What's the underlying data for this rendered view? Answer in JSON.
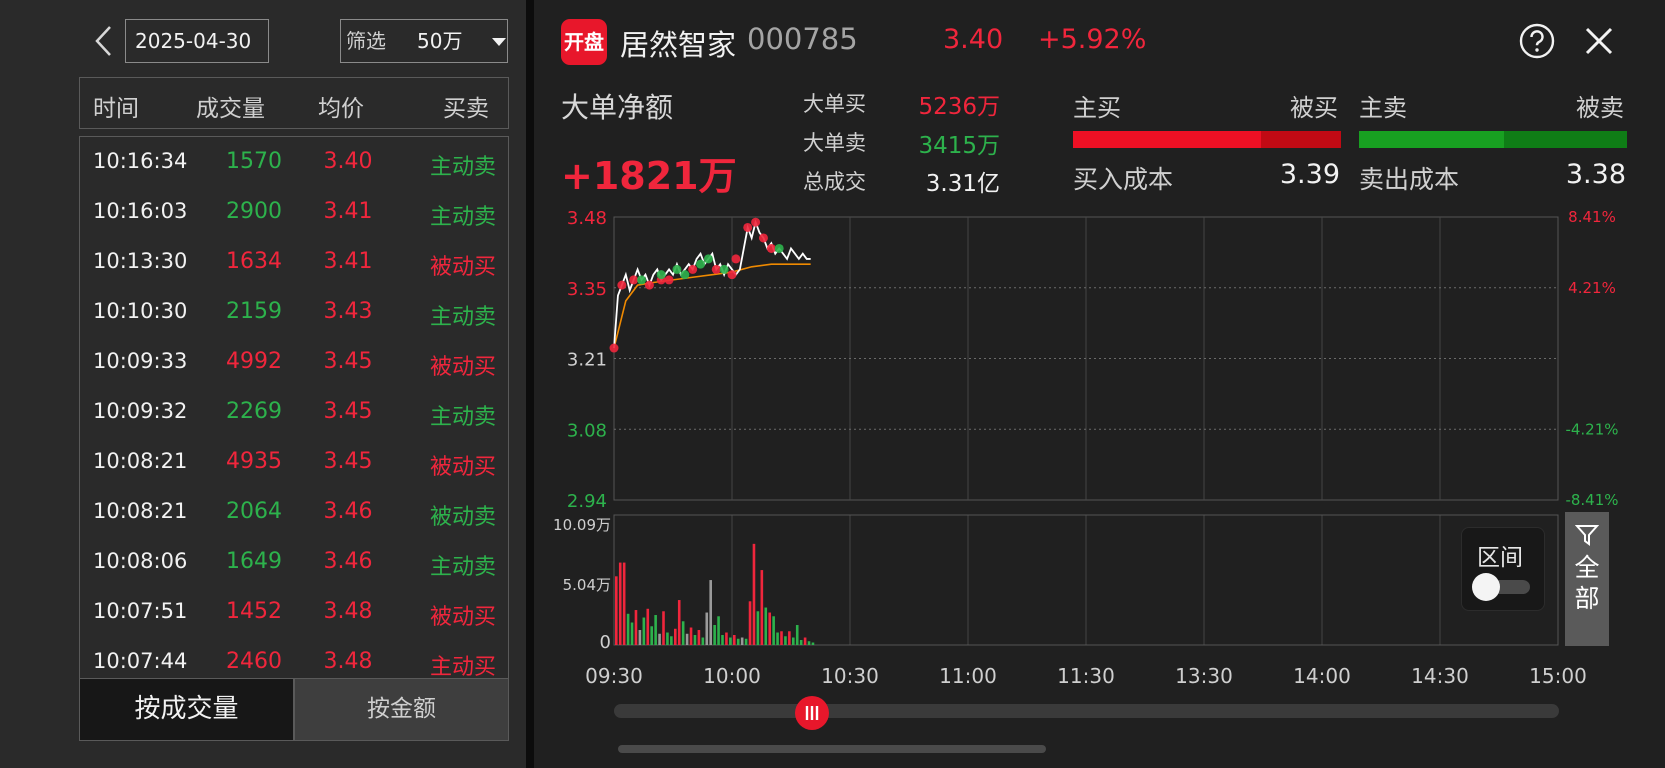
{
  "left": {
    "date": "2025-04-30",
    "filter": {
      "label": "筛选",
      "value": "50万"
    },
    "columns": [
      "时间",
      "成交量",
      "均价",
      "买卖"
    ],
    "rows": [
      {
        "time": "10:16:34",
        "volume": "1570",
        "price": "3.40",
        "type": "主动卖",
        "vol_color": "green",
        "type_color": "green"
      },
      {
        "time": "10:16:03",
        "volume": "2900",
        "price": "3.41",
        "type": "主动卖",
        "vol_color": "green",
        "type_color": "green"
      },
      {
        "time": "10:13:30",
        "volume": "1634",
        "price": "3.41",
        "type": "被动买",
        "vol_color": "red",
        "type_color": "red"
      },
      {
        "time": "10:10:30",
        "volume": "2159",
        "price": "3.43",
        "type": "主动卖",
        "vol_color": "green",
        "type_color": "green"
      },
      {
        "time": "10:09:33",
        "volume": "4992",
        "price": "3.45",
        "type": "被动买",
        "vol_color": "red",
        "type_color": "red"
      },
      {
        "time": "10:09:32",
        "volume": "2269",
        "price": "3.45",
        "type": "主动卖",
        "vol_color": "green",
        "type_color": "green"
      },
      {
        "time": "10:08:21",
        "volume": "4935",
        "price": "3.45",
        "type": "被动买",
        "vol_color": "red",
        "type_color": "red"
      },
      {
        "time": "10:08:21",
        "volume": "2064",
        "price": "3.46",
        "type": "被动卖",
        "vol_color": "green",
        "type_color": "green"
      },
      {
        "time": "10:08:06",
        "volume": "1649",
        "price": "3.46",
        "type": "主动卖",
        "vol_color": "green",
        "type_color": "green"
      },
      {
        "time": "10:07:51",
        "volume": "1452",
        "price": "3.48",
        "type": "被动买",
        "vol_color": "red",
        "type_color": "red"
      },
      {
        "time": "10:07:44",
        "volume": "2460",
        "price": "3.48",
        "type": "主动买",
        "vol_color": "red",
        "type_color": "red"
      }
    ],
    "tabs": {
      "by_volume": "按成交量",
      "by_amount": "按金额"
    }
  },
  "header": {
    "logo": "开盘",
    "name": "居然智家",
    "code": "000785",
    "price": "3.40",
    "change": "+5.92%"
  },
  "summary": {
    "title": "大单净额",
    "net": "+1821万",
    "big_buy_label": "大单买",
    "big_buy": "5236万",
    "big_sell_label": "大单卖",
    "big_sell": "3415万",
    "total_label": "总成交",
    "total": "3.31亿"
  },
  "flow": {
    "buy_active": "主买",
    "buy_passive": "被买",
    "sell_active": "主卖",
    "sell_passive": "被卖",
    "buy_active_share": 0.7,
    "sell_active_share": 0.54,
    "buy_cost_label": "买入成本",
    "buy_cost": "3.39",
    "sell_cost_label": "卖出成本",
    "sell_cost": "3.38"
  },
  "colors": {
    "red": "#f0263c",
    "green": "#2db24c",
    "avg_line": "#f08a00",
    "price_line": "#ffffff"
  },
  "chart_data": {
    "type": "line",
    "price_ticks": [
      "3.48",
      "3.35",
      "3.21",
      "3.08",
      "2.94"
    ],
    "pct_ticks": [
      "8.41%",
      "4.21%",
      "",
      "-4.21%",
      "-8.41%"
    ],
    "prev_close": 3.21,
    "ylim": [
      2.94,
      3.48
    ],
    "x_ticks": [
      "09:30",
      "10:00",
      "10:30",
      "11:00",
      "11:30",
      "13:30",
      "14:00",
      "14:30",
      "15:00"
    ],
    "grid": true,
    "price_series": {
      "minutes": [
        0,
        1,
        2,
        3,
        4,
        5,
        6,
        7,
        8,
        9,
        10,
        11,
        12,
        13,
        14,
        15,
        16,
        17,
        18,
        19,
        20,
        21,
        22,
        23,
        24,
        25,
        26,
        27,
        28,
        29,
        30,
        31,
        32,
        33,
        34,
        35,
        36,
        37,
        38,
        39,
        40,
        41,
        42,
        43,
        44,
        45,
        46,
        47,
        48,
        49,
        50
      ],
      "values": [
        3.23,
        3.33,
        3.35,
        3.37,
        3.34,
        3.36,
        3.38,
        3.36,
        3.37,
        3.35,
        3.37,
        3.38,
        3.36,
        3.37,
        3.38,
        3.37,
        3.39,
        3.37,
        3.38,
        3.39,
        3.38,
        3.4,
        3.41,
        3.39,
        3.4,
        3.41,
        3.38,
        3.39,
        3.37,
        3.39,
        3.38,
        3.37,
        3.38,
        3.42,
        3.46,
        3.44,
        3.47,
        3.45,
        3.44,
        3.42,
        3.43,
        3.41,
        3.42,
        3.41,
        3.4,
        3.42,
        3.41,
        3.4,
        3.41,
        3.4,
        3.4
      ]
    },
    "avg_series": {
      "minutes": [
        0,
        3,
        6,
        10,
        15,
        20,
        25,
        30,
        35,
        40,
        45,
        50
      ],
      "values": [
        3.23,
        3.32,
        3.35,
        3.355,
        3.36,
        3.365,
        3.37,
        3.375,
        3.385,
        3.39,
        3.39,
        3.39
      ]
    },
    "trade_markers": [
      {
        "minute": 0,
        "price": 3.23,
        "side": "buy"
      },
      {
        "minute": 2,
        "price": 3.35,
        "side": "buy"
      },
      {
        "minute": 5,
        "price": 3.36,
        "side": "buy"
      },
      {
        "minute": 7,
        "price": 3.36,
        "side": "sell"
      },
      {
        "minute": 9,
        "price": 3.35,
        "side": "buy"
      },
      {
        "minute": 12,
        "price": 3.36,
        "side": "buy"
      },
      {
        "minute": 12,
        "price": 3.37,
        "side": "sell"
      },
      {
        "minute": 14,
        "price": 3.36,
        "side": "buy"
      },
      {
        "minute": 16,
        "price": 3.38,
        "side": "sell"
      },
      {
        "minute": 18,
        "price": 3.37,
        "side": "sell"
      },
      {
        "minute": 20,
        "price": 3.38,
        "side": "buy"
      },
      {
        "minute": 22,
        "price": 3.39,
        "side": "sell"
      },
      {
        "minute": 24,
        "price": 3.4,
        "side": "sell"
      },
      {
        "minute": 26,
        "price": 3.38,
        "side": "buy"
      },
      {
        "minute": 28,
        "price": 3.38,
        "side": "sell"
      },
      {
        "minute": 30,
        "price": 3.37,
        "side": "buy"
      },
      {
        "minute": 31,
        "price": 3.4,
        "side": "buy"
      },
      {
        "minute": 34,
        "price": 3.46,
        "side": "buy"
      },
      {
        "minute": 36,
        "price": 3.47,
        "side": "buy"
      },
      {
        "minute": 38,
        "price": 3.44,
        "side": "buy"
      },
      {
        "minute": 40,
        "price": 3.42,
        "side": "buy"
      },
      {
        "minute": 42,
        "price": 3.42,
        "side": "sell"
      }
    ],
    "volume": {
      "ticks": [
        "10.09万",
        "5.04万",
        "0"
      ],
      "max": 10.09,
      "bars": [
        {
          "minute": 0,
          "value": 5.5,
          "side": "buy"
        },
        {
          "minute": 1,
          "value": 6.6,
          "side": "buy"
        },
        {
          "minute": 2,
          "value": 6.6,
          "side": "buy"
        },
        {
          "minute": 3,
          "value": 2.5,
          "side": "sell"
        },
        {
          "minute": 4,
          "value": 1.8,
          "side": "sell"
        },
        {
          "minute": 5,
          "value": 2.8,
          "side": "buy"
        },
        {
          "minute": 6,
          "value": 1.2,
          "side": "neutral"
        },
        {
          "minute": 7,
          "value": 2.2,
          "side": "sell"
        },
        {
          "minute": 8,
          "value": 2.9,
          "side": "buy"
        },
        {
          "minute": 9,
          "value": 1.5,
          "side": "sell"
        },
        {
          "minute": 10,
          "value": 2.4,
          "side": "sell"
        },
        {
          "minute": 11,
          "value": 0.9,
          "side": "neutral"
        },
        {
          "minute": 12,
          "value": 2.7,
          "side": "buy"
        },
        {
          "minute": 13,
          "value": 1.0,
          "side": "sell"
        },
        {
          "minute": 14,
          "value": 0.7,
          "side": "sell"
        },
        {
          "minute": 15,
          "value": 1.3,
          "side": "buy"
        },
        {
          "minute": 16,
          "value": 3.6,
          "side": "buy"
        },
        {
          "minute": 17,
          "value": 1.9,
          "side": "sell"
        },
        {
          "minute": 18,
          "value": 0.9,
          "side": "neutral"
        },
        {
          "minute": 19,
          "value": 1.4,
          "side": "buy"
        },
        {
          "minute": 20,
          "value": 0.8,
          "side": "sell"
        },
        {
          "minute": 21,
          "value": 1.2,
          "side": "buy"
        },
        {
          "minute": 22,
          "value": 0.6,
          "side": "sell"
        },
        {
          "minute": 23,
          "value": 2.6,
          "side": "neutral"
        },
        {
          "minute": 24,
          "value": 5.2,
          "side": "neutral"
        },
        {
          "minute": 25,
          "value": 1.6,
          "side": "sell"
        },
        {
          "minute": 26,
          "value": 2.3,
          "side": "sell"
        },
        {
          "minute": 27,
          "value": 0.8,
          "side": "sell"
        },
        {
          "minute": 28,
          "value": 1.0,
          "side": "buy"
        },
        {
          "minute": 29,
          "value": 0.6,
          "side": "sell"
        },
        {
          "minute": 30,
          "value": 0.8,
          "side": "buy"
        },
        {
          "minute": 31,
          "value": 0.5,
          "side": "sell"
        },
        {
          "minute": 32,
          "value": 0.6,
          "side": "neutral"
        },
        {
          "minute": 33,
          "value": 0.5,
          "side": "sell"
        },
        {
          "minute": 34,
          "value": 3.5,
          "side": "buy"
        },
        {
          "minute": 35,
          "value": 8.1,
          "side": "buy"
        },
        {
          "minute": 36,
          "value": 2.7,
          "side": "sell"
        },
        {
          "minute": 37,
          "value": 6.0,
          "side": "buy"
        },
        {
          "minute": 38,
          "value": 3.0,
          "side": "sell"
        },
        {
          "minute": 39,
          "value": 2.6,
          "side": "buy"
        },
        {
          "minute": 40,
          "value": 2.3,
          "side": "sell"
        },
        {
          "minute": 41,
          "value": 1.0,
          "side": "sell"
        },
        {
          "minute": 42,
          "value": 1.1,
          "side": "buy"
        },
        {
          "minute": 43,
          "value": 0.7,
          "side": "sell"
        },
        {
          "minute": 44,
          "value": 1.1,
          "side": "buy"
        },
        {
          "minute": 45,
          "value": 0.6,
          "side": "sell"
        },
        {
          "minute": 46,
          "value": 1.6,
          "side": "sell"
        },
        {
          "minute": 47,
          "value": 0.4,
          "side": "sell"
        },
        {
          "minute": 48,
          "value": 0.6,
          "side": "buy"
        },
        {
          "minute": 49,
          "value": 0.3,
          "side": "sell"
        },
        {
          "minute": 50,
          "value": 0.2,
          "side": "sell"
        }
      ]
    }
  },
  "controls": {
    "range_label": "区间",
    "range_enabled": false,
    "all_label": "全\n部",
    "timeline_position": 0.21
  }
}
